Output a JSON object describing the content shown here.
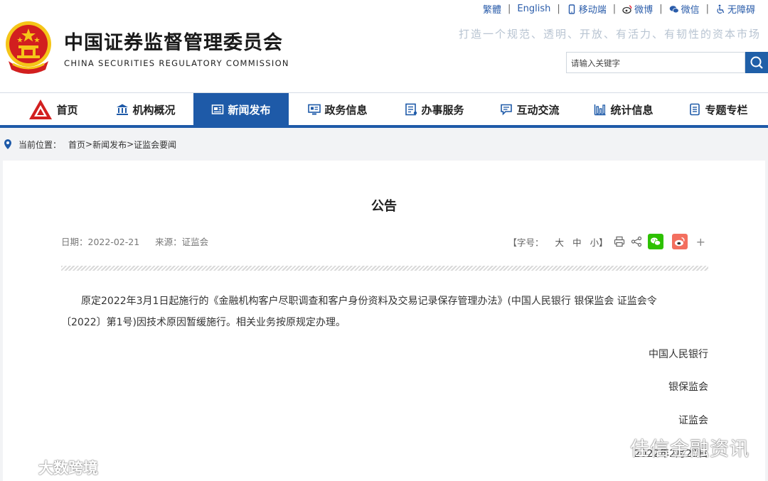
{
  "header": {
    "site_name_cn": "中国证券监督管理委员会",
    "site_name_en": "CHINA SECURITIES REGULATORY COMMISSION",
    "slogan": "打造一个规范、透明、开放、有活力、有韧性的资本市场",
    "top_links": {
      "traditional": "繁體",
      "english": "English",
      "mobile": "移动端",
      "weibo": "微博",
      "wechat": "微信",
      "accessibility": "无障碍"
    },
    "search": {
      "placeholder": "请输入关键字"
    }
  },
  "nav": {
    "items": [
      {
        "label": "首页",
        "icon": "csrc-logo-icon"
      },
      {
        "label": "机构概况",
        "icon": "building-icon"
      },
      {
        "label": "新闻发布",
        "icon": "newspaper-icon",
        "active": true
      },
      {
        "label": "政务信息",
        "icon": "monitor-icon"
      },
      {
        "label": "办事服务",
        "icon": "form-icon"
      },
      {
        "label": "互动交流",
        "icon": "chat-icon"
      },
      {
        "label": "统计信息",
        "icon": "bar-chart-icon"
      },
      {
        "label": "专题专栏",
        "icon": "document-icon"
      }
    ]
  },
  "breadcrumb": {
    "prefix": "当前位置：",
    "items": [
      "首页",
      "新闻发布",
      "证监会要闻"
    ],
    "separator": ">"
  },
  "article": {
    "title": "公告",
    "date_label": "日期：",
    "date": "2022-02-21",
    "source_label": "来源：",
    "source": "证监会",
    "font_size_label": "【字号：",
    "font_sizes": [
      "大",
      "中",
      "小】"
    ],
    "share_more": "+",
    "paragraph_1": "原定2022年3月1日起施行的《金融机构客户尽职调查和客户身份资料及交易记录保存管理办法》(中国人民银行 银保监会 证监会令〔2022〕第1号)因技术原因暂缓施行。相关业务按原规定办理。",
    "signatures": [
      "中国人民银行",
      "银保监会",
      "证监会",
      "2022年2月21日"
    ]
  },
  "watermarks": {
    "left": "大数跨境",
    "right": "佳信金融资讯"
  },
  "colors": {
    "brand_blue": "#1e5aa8",
    "emblem_red": "#d21f1f",
    "emblem_gold": "#f5c518",
    "wechat_green": "#2dc100",
    "weibo_red": "#e6162d"
  }
}
